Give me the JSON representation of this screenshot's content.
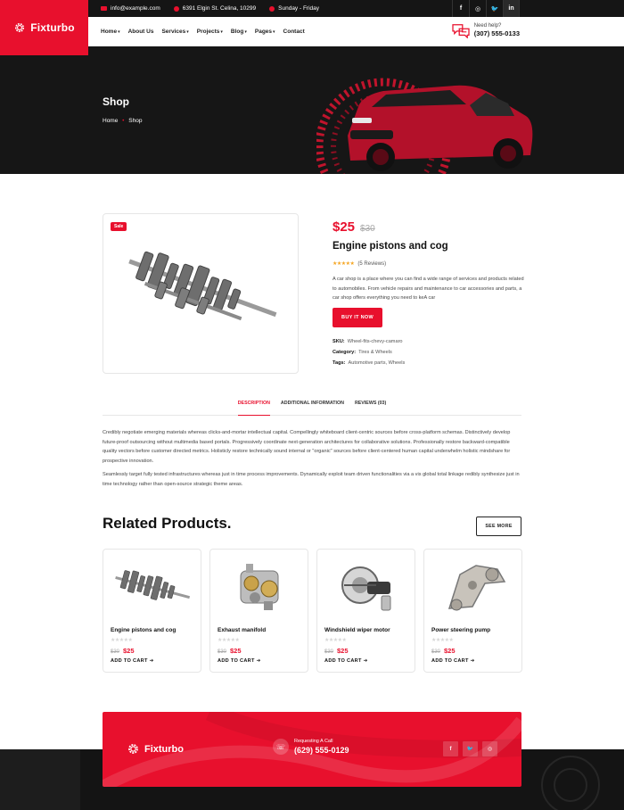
{
  "brand": {
    "name": "Fixturbo",
    "accent": "#e8102d",
    "dark": "#161616"
  },
  "topbar": {
    "email": "info@example.com",
    "address": "6391 Elgin St. Celina, 10299",
    "hours": "Sunday - Friday",
    "socials": [
      "f",
      "◎",
      "🐦",
      "in"
    ]
  },
  "nav": {
    "items": [
      {
        "label": "Home",
        "dropdown": true
      },
      {
        "label": "About Us",
        "dropdown": false
      },
      {
        "label": "Services",
        "dropdown": true
      },
      {
        "label": "Projects",
        "dropdown": true
      },
      {
        "label": "Blog",
        "dropdown": true
      },
      {
        "label": "Pages",
        "dropdown": true
      },
      {
        "label": "Contact",
        "dropdown": false
      }
    ],
    "help_label": "Need help?",
    "help_phone": "(307) 555-0133"
  },
  "hero": {
    "title": "Shop",
    "crumb_home": "Home",
    "crumb_sep": "•",
    "crumb_current": "Shop"
  },
  "product": {
    "badge": "Sale",
    "price": "$25",
    "old_price": "$30",
    "name": "Engine pistons and cog",
    "stars": "★★★★★",
    "reviews": "(5 Reviews)",
    "description": "A car shop is a place where you can find a wide range of services and products related to automobiles. From vehicle repairs and maintenance to car accessories and parts, a car shop offers everything you need to keA car",
    "buy_label": "BUY IT NOW",
    "sku_label": "SKU:",
    "sku": "Wheel-fits-chevy-camaro",
    "category_label": "Category:",
    "category": "Tires & Wheels",
    "tags_label": "Tags:",
    "tags": "Automotive parts, Wheels"
  },
  "tabs": [
    "DESCRIPTION",
    "ADDITIONAL INFORMATION",
    "REVIEWS (03)"
  ],
  "description": {
    "p1": "Credibly negotiate emerging materials whereas clicks-and-mortar intellectual capital. Compellingly whiteboard client-centric sources before cross-platform schemas. Distinctively develop future-proof outsourcing without multimedia based portals. Progressively coordinate next-generation architectures for collaborative solutions. Professionally restore backward-compatible quality vectors before customer directed metrics. Holisticly restore technically sound internal or \"organic\" sources before client-centered human capital underwhelm holistic mindshare for prospective innovation.",
    "p2": "Seamlessly target fully tested infrastructures whereas just in time process improvements. Dynamically exploit team driven functionalities via a vis global total linkage redibly synthesize just in time technology rather than open-source strategic theme areas."
  },
  "related": {
    "title": "Related Products.",
    "see_more": "SEE MORE",
    "products": [
      {
        "name": "Engine pistons and cog",
        "old": "$30",
        "price": "$25",
        "stars": "★★★★★",
        "cta": "ADD TO CART ➔"
      },
      {
        "name": "Exhaust manifold",
        "old": "$30",
        "price": "$25",
        "stars": "★★★★★",
        "cta": "ADD TO CART ➔"
      },
      {
        "name": "Windshield wiper motor",
        "old": "$30",
        "price": "$25",
        "stars": "★★★★★",
        "cta": "ADD TO CART ➔"
      },
      {
        "name": "Power steering pump",
        "old": "$30",
        "price": "$25",
        "stars": "★★★★★",
        "cta": "ADD TO CART ➔"
      }
    ]
  },
  "footer": {
    "brand": "Fixturbo",
    "call_label": "Requesting A Call",
    "call_phone": "(629) 555-0129",
    "socials": [
      "f",
      "🐦",
      "◎"
    ]
  }
}
